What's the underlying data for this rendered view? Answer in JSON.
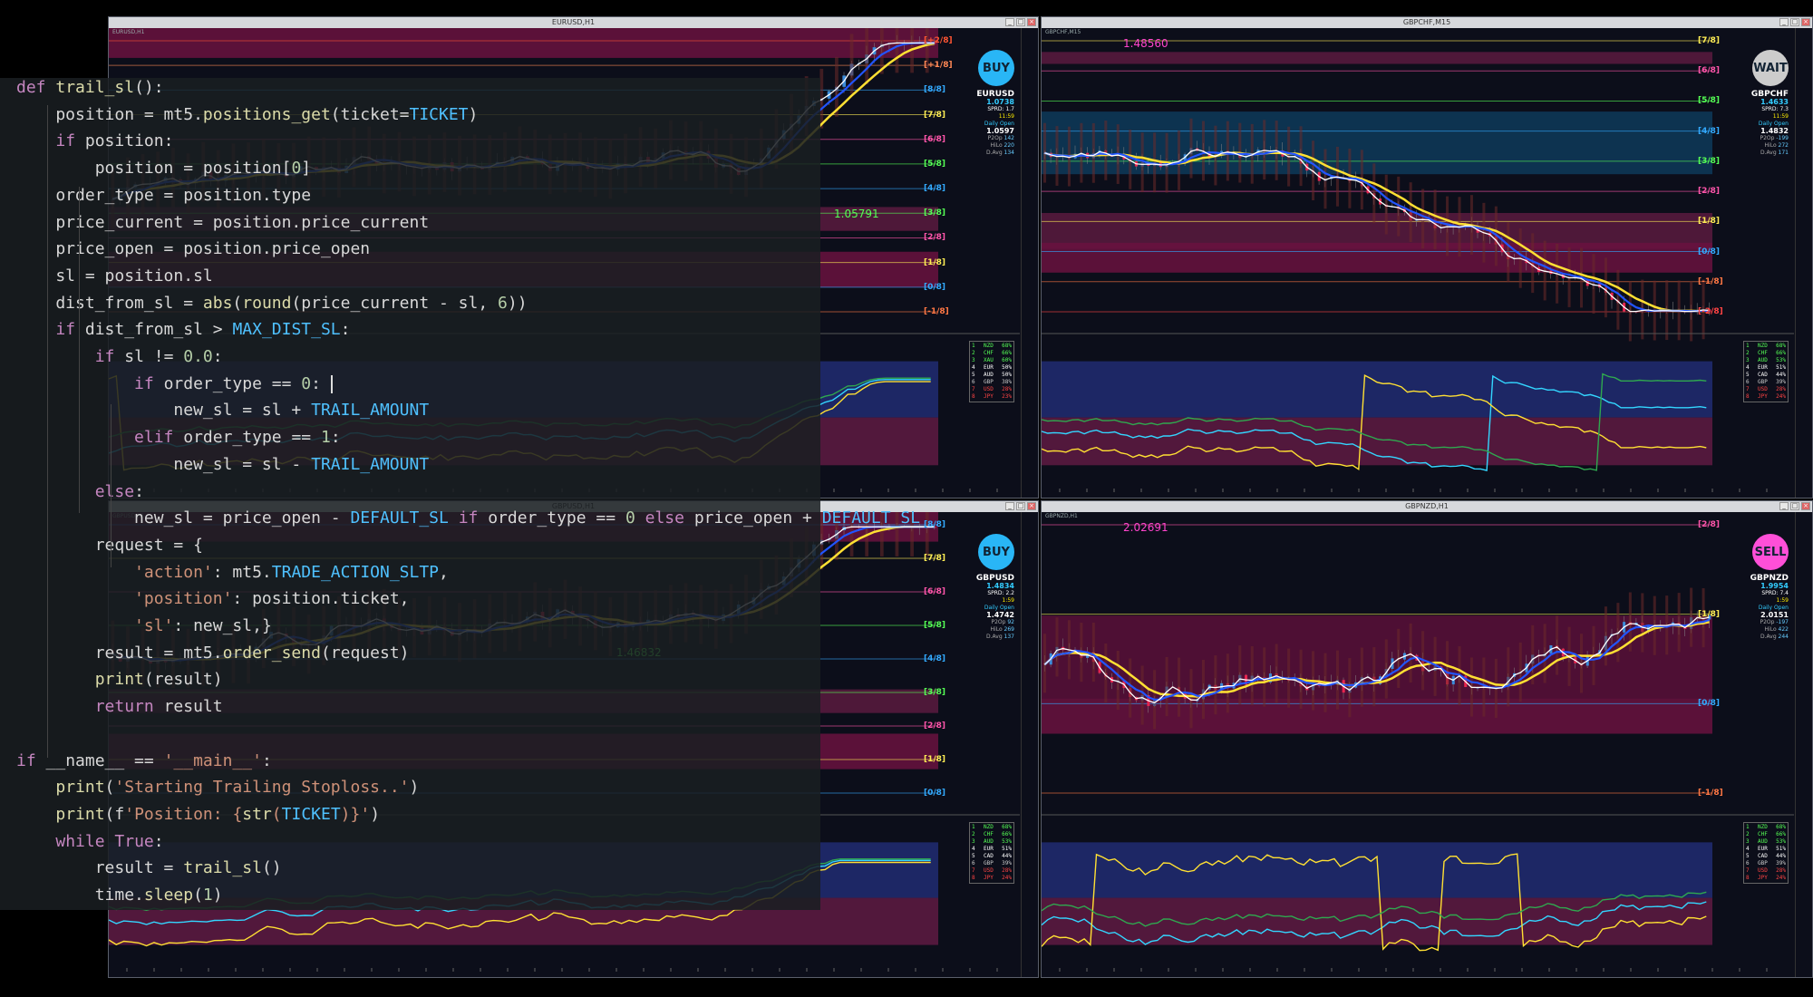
{
  "charts": [
    {
      "title": "EURUSD,H1",
      "symbol_label": "EURUSD,H1",
      "signal": "BUY",
      "signal_color": "#29b6f6",
      "pair": "EURUSD",
      "price": "1.0738",
      "spread": "SPRD: 1.7",
      "time": "11:59",
      "daily_open_label": "Daily Open",
      "daily_open": "1.0597",
      "stats": [
        [
          "P2Op",
          "142"
        ],
        [
          "HiLo",
          "220"
        ],
        [
          "D.Avg",
          "134"
        ]
      ],
      "price_label": "1.05791",
      "levels": [
        "[+2/8]",
        "[+1/8]",
        "[8/8]",
        "[7/8]",
        "[6/8]",
        "[5/8]",
        "[4/8]",
        "[3/8]",
        "[2/8]",
        "[1/8]",
        "[0/8]",
        "[-1/8]"
      ]
    },
    {
      "title": "GBPCHF,M15",
      "symbol_label": "GBPCHF,M15",
      "signal": "WAIT",
      "signal_color": "#cccccc",
      "pair": "GBPCHF",
      "price": "1.4633",
      "spread": "SPRD: 7.3",
      "time": "11:59",
      "daily_open_label": "Daily Open",
      "daily_open": "1.4832",
      "stats": [
        [
          "P2Op",
          "-199"
        ],
        [
          "HiLo",
          "272"
        ],
        [
          "D.Avg",
          "171"
        ]
      ],
      "price_label": "1.48560",
      "levels": [
        "[7/8]",
        "[6/8]",
        "[5/8]",
        "[4/8]",
        "[3/8]",
        "[2/8]",
        "[1/8]",
        "[0/8]",
        "[-1/8]",
        "[-2/8]"
      ]
    },
    {
      "title": "GBPUSD,H1",
      "symbol_label": "GBPUSD,H1",
      "signal": "BUY",
      "signal_color": "#29b6f6",
      "pair": "GBPUSD",
      "price": "1.4834",
      "spread": "SPRD: 2.2",
      "time": "1:59",
      "daily_open_label": "Daily Open",
      "daily_open": "1.4742",
      "stats": [
        [
          "P2Op",
          "92"
        ],
        [
          "HiLo",
          "269"
        ],
        [
          "D.Avg",
          "137"
        ]
      ],
      "price_label": "1.46832",
      "levels": [
        "[8/8]",
        "[7/8]",
        "[6/8]",
        "[5/8]",
        "[4/8]",
        "[3/8]",
        "[2/8]",
        "[1/8]",
        "[0/8]"
      ]
    },
    {
      "title": "GBPNZD,H1",
      "symbol_label": "GBPNZD,H1",
      "signal": "SELL",
      "signal_color": "#ff4fd8",
      "pair": "GBPNZD",
      "price": "1.9954",
      "spread": "SPRD: 7.4",
      "time": "1:59",
      "daily_open_label": "Daily Open",
      "daily_open": "2.0151",
      "stats": [
        [
          "P2Op",
          "-197"
        ],
        [
          "HiLo",
          "422"
        ],
        [
          "D.Avg",
          "244"
        ]
      ],
      "price_label": "2.02691",
      "levels": [
        "[2/8]",
        "[1/8]",
        "[0/8]",
        "[-1/8]"
      ]
    }
  ],
  "strength": [
    [
      "1",
      "NZD",
      "68%"
    ],
    [
      "2",
      "CHF",
      "66%"
    ],
    [
      "3",
      "XAU",
      "60%"
    ],
    [
      "4",
      "EUR",
      "50%"
    ],
    [
      "5",
      "AUD",
      "50%"
    ],
    [
      "6",
      "GBP",
      "38%"
    ],
    [
      "7",
      "USD",
      "28%"
    ],
    [
      "8",
      "JPY",
      "23%"
    ]
  ],
  "strength_alt": [
    [
      "1",
      "NZD",
      "68%"
    ],
    [
      "2",
      "CHF",
      "66%"
    ],
    [
      "3",
      "AUD",
      "53%"
    ],
    [
      "4",
      "EUR",
      "51%"
    ],
    [
      "5",
      "CAD",
      "44%"
    ],
    [
      "6",
      "GBP",
      "39%"
    ],
    [
      "7",
      "USD",
      "28%"
    ],
    [
      "8",
      "JPY",
      "24%"
    ]
  ],
  "code_lines": [
    "def trail_sl():",
    "    position = mt5.positions_get(ticket=TICKET)",
    "    if position:",
    "        position = position[0]",
    "    order_type = position.type",
    "    price_current = position.price_current",
    "    price_open = position.price_open",
    "    sl = position.sl",
    "    dist_from_sl = abs(round(price_current - sl, 6))",
    "    if dist_from_sl > MAX_DIST_SL:",
    "        if sl != 0.0:",
    "            if order_type == 0:",
    "                new_sl = sl + TRAIL_AMOUNT",
    "            elif order_type == 1:",
    "                new_sl = sl - TRAIL_AMOUNT",
    "        else:",
    "            new_sl = price_open - DEFAULT_SL if order_type == 0 else price_open + DEFAULT_SL",
    "        request = {",
    "            'action': mt5.TRADE_ACTION_SLTP,",
    "            'position': position.ticket,",
    "            'sl': new_sl,}",
    "        result = mt5.order_send(request)",
    "        print(result)",
    "        return result",
    "",
    "if __name__ == '__main__':",
    "    print('Starting Trailing Stoploss..')",
    "    print(f'Position: {str(TICKET)}')",
    "    while True:",
    "        result = trail_sl()",
    "        time.sleep(1)"
  ]
}
